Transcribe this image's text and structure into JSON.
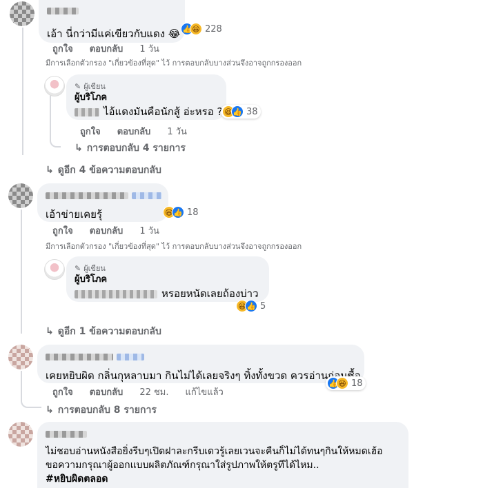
{
  "comments": [
    {
      "text": "เอ้า นี่กว่ามีแค่เขียวกับแดง 😂",
      "reaction_count": "228",
      "actions": {
        "like": "ถูกใจ",
        "reply": "ตอบกลับ",
        "time": "1 วัน"
      },
      "filter_note": "มีการเลือกตัวกรอง \"เกี่ยวข้องที่สุด\" ไว้ การตอบกลับบางส่วนจึงอาจถูกกรองออก",
      "reply": {
        "author_label": "ผู้เขียน",
        "author_name": "ผู้บริโภค",
        "text": "ไอ้แดงมันคือนักสู้ อ่ะหรอ ?",
        "reaction_count": "38",
        "actions": {
          "like": "ถูกใจ",
          "reply": "ตอบกลับ",
          "time": "1 วัน"
        },
        "more_replies": "การตอบกลับ 4 รายการ"
      },
      "view_more": "ดูอีก 4 ข้อความตอบกลับ"
    },
    {
      "text": "เอ้าข่ายเคยรุ้",
      "reaction_count": "18",
      "actions": {
        "like": "ถูกใจ",
        "reply": "ตอบกลับ",
        "time": "1 วัน"
      },
      "filter_note": "มีการเลือกตัวกรอง \"เกี่ยวข้องที่สุด\" ไว้ การตอบกลับบางส่วนจึงอาจถูกกรองออก",
      "reply": {
        "author_label": "ผู้เขียน",
        "author_name": "ผู้บริโภค",
        "text": "หรอยหนัดเลยถ้องบ่าว",
        "reaction_count": "5"
      },
      "view_more": "ดูอีก 1 ข้อความตอบกลับ"
    },
    {
      "text": "เคยหยิบผิด กลิ่นกุหลาบมา กินไม่ได้เลยจริงๆ ทิ้งทั้งขวด ควรอ่านก่อนซื้อ",
      "reaction_count": "18",
      "actions": {
        "like": "ถูกใจ",
        "reply": "ตอบกลับ",
        "time": "22 ชม.",
        "edited": "แก้ไขแล้ว"
      },
      "more_replies": "การตอบกลับ 8 รายการ"
    },
    {
      "text_line1": "ไม่ชอบอ่านหนังสือยิ่งรีบๆเปิดฝาละกรีบเดวรู้เลยเวนจะคืนก็ไม่ได้ทนๆกินให้หมดเฮ้อ",
      "text_line2": "ขอความกรุณาผู้ออกแบบผลิตภัณฑ์กรุณาใส่รูปภาพให้ตรูทีได้ไหม..",
      "hashtag": "#หยิบผิดตลอด"
    }
  ],
  "icons": {
    "haha": "haha-reaction-icon",
    "like": "like-reaction-icon",
    "reply_arrow": "reply-arrow-icon",
    "author_pen": "pen-icon"
  },
  "colors": {
    "bubble": "#f0f2f5",
    "secondary_text": "#65676b",
    "like_blue": "#1877f2",
    "haha_yellow": "#f7b928"
  }
}
